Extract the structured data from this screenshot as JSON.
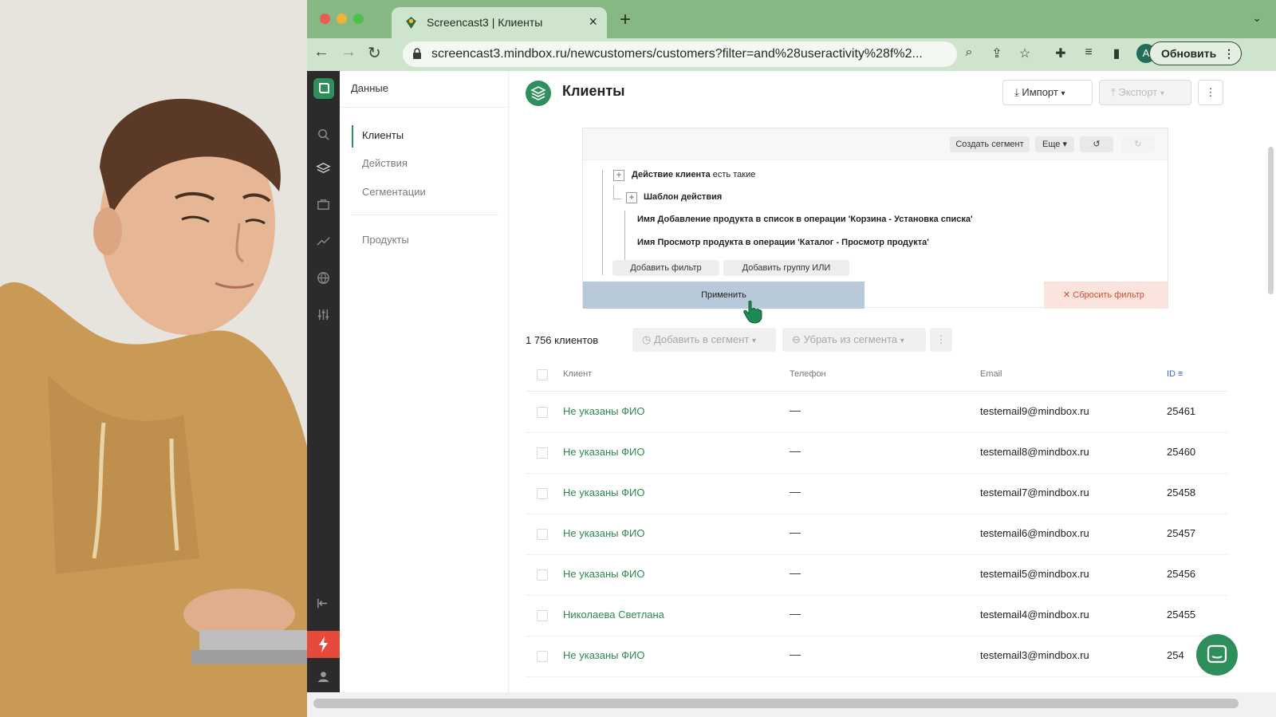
{
  "browser": {
    "tab_title": "Screencast3 | Клиенты",
    "url": "screencast3.mindbox.ru/newcustomers/customers?filter=and%28useractivity%28f%2...",
    "profile_initial": "A",
    "update_label": "Обновить"
  },
  "section_nav": {
    "header": "Данные",
    "items": [
      "Клиенты",
      "Действия",
      "Сегментации"
    ],
    "extra_item": "Продукты"
  },
  "page": {
    "title": "Клиенты",
    "import_label": "Импорт",
    "export_label": "Экспорт"
  },
  "filter": {
    "create_segment": "Создать сегмент",
    "more": "Еще",
    "row1_bold": "Действие клиента",
    "row1_rest": " есть такие",
    "row2": "Шаблон действия",
    "row3": "Имя Добавление продукта в список в операции 'Корзина - Установка списка'",
    "row4": "Имя Просмотр продукта в операции 'Каталог - Просмотр продукта'",
    "add_filter": "Добавить фильтр",
    "add_or_group": "Добавить группу ИЛИ",
    "apply": "Применить",
    "reset": "Сбросить фильтр"
  },
  "list": {
    "count": "1 756 клиентов",
    "add_to_segment": "Добавить в сегмент",
    "remove_from_segment": "Убрать из сегмента"
  },
  "table": {
    "headers": {
      "client": "Клиент",
      "phone": "Телефон",
      "email": "Email",
      "id": "ID"
    },
    "rows": [
      {
        "name": "Не указаны ФИО",
        "phone": "—",
        "email": "testemail9@mindbox.ru",
        "id": "25461"
      },
      {
        "name": "Не указаны ФИО",
        "phone": "—",
        "email": "testemail8@mindbox.ru",
        "id": "25460"
      },
      {
        "name": "Не указаны ФИО",
        "phone": "—",
        "email": "testemail7@mindbox.ru",
        "id": "25458"
      },
      {
        "name": "Не указаны ФИО",
        "phone": "—",
        "email": "testemail6@mindbox.ru",
        "id": "25457"
      },
      {
        "name": "Не указаны ФИО",
        "phone": "—",
        "email": "testemail5@mindbox.ru",
        "id": "25456"
      },
      {
        "name": "Николаева Светлана",
        "phone": "—",
        "email": "testemail4@mindbox.ru",
        "id": "25455"
      },
      {
        "name": "Не указаны ФИО",
        "phone": "—",
        "email": "testemail3@mindbox.ru",
        "id": "254"
      }
    ]
  },
  "colors": {
    "brand": "#2f8f5c",
    "link": "#2e8a4e",
    "danger": "#d44a33",
    "apply_bg": "#b8cad9"
  }
}
